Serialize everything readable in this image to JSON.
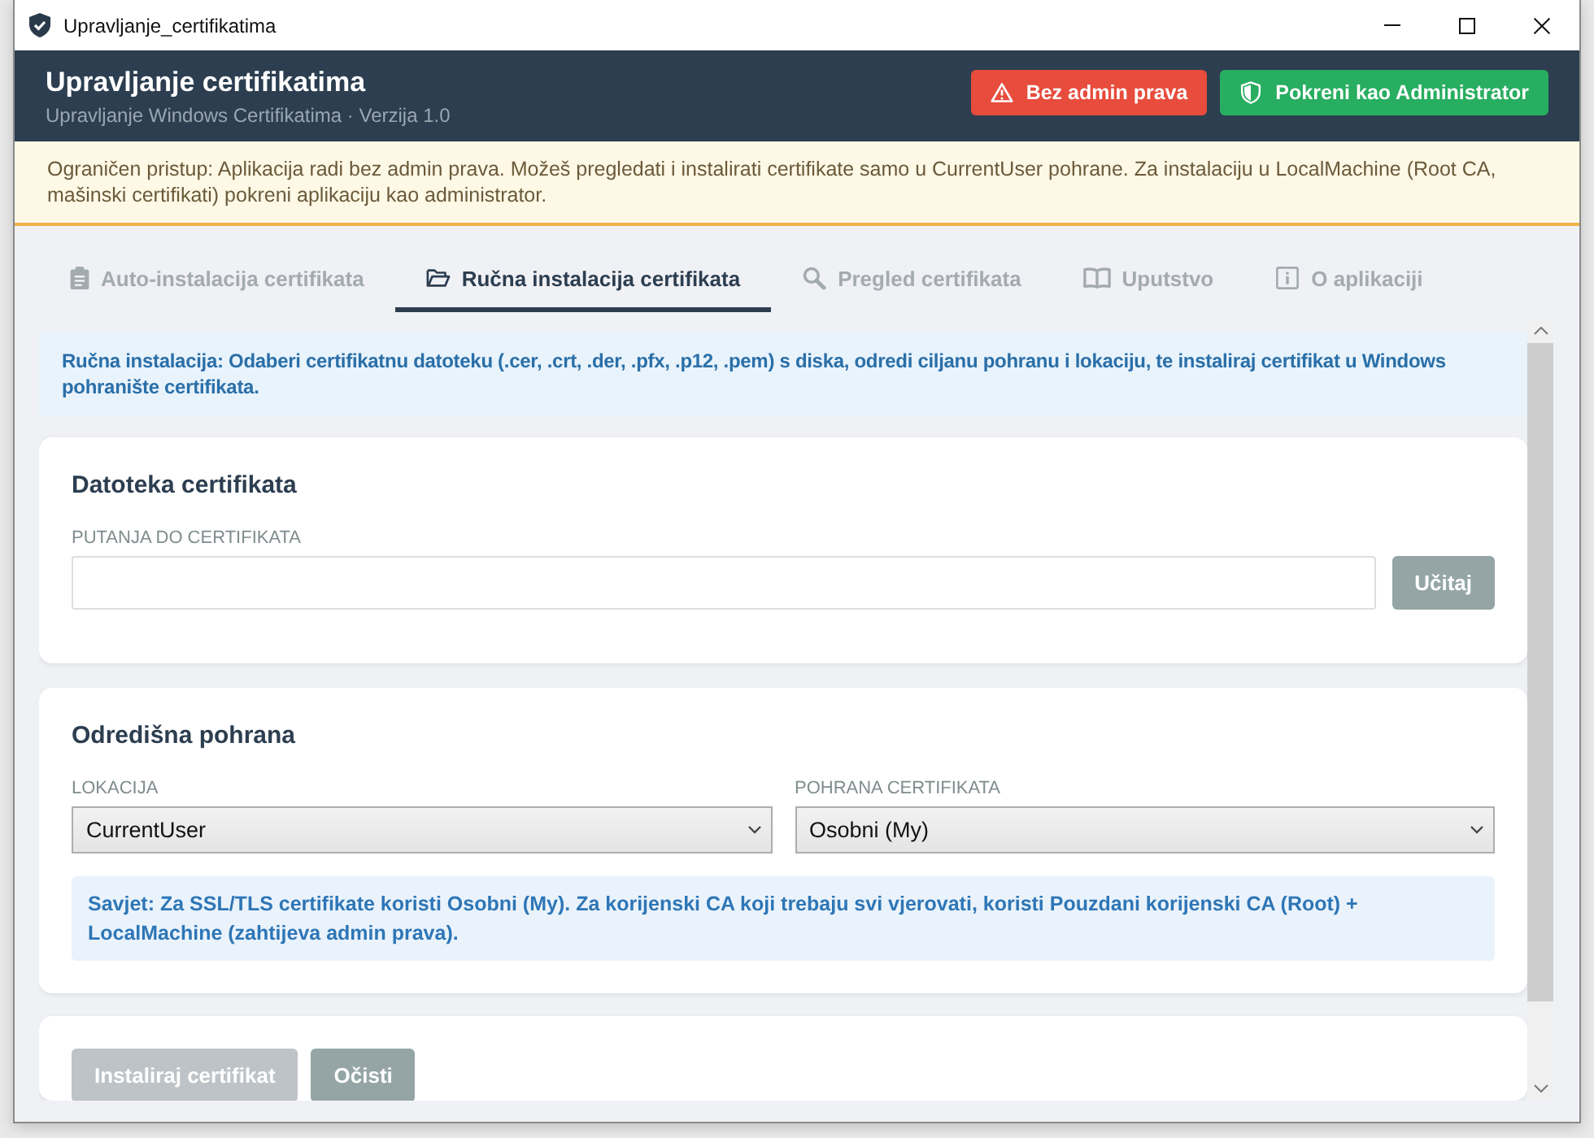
{
  "window": {
    "title": "Upravljanje_certifikatima"
  },
  "header": {
    "title": "Upravljanje certifikatima",
    "subtitle": "Upravljanje Windows Certifikatima · Verzija 1.0",
    "buttons": [
      {
        "kind": "warning",
        "label": "Bez admin prava"
      },
      {
        "kind": "elevate",
        "label": "Pokreni kao Administrator"
      }
    ]
  },
  "access_banner": {
    "text": "Ograničen pristup: Aplikacija radi bez admin prava. Možeš pregledati i instalirati certifikate samo u CurrentUser pohrane. Za instalaciju u LocalMachine (Root CA, mašinski certifikati) pokreni aplikaciju kao administrator."
  },
  "tabs": [
    {
      "label": "Auto-instalacija certifikata",
      "selected": false
    },
    {
      "label": "Ručna instalacija certifikata",
      "selected": true
    },
    {
      "label": "Pregled certifikata",
      "selected": false
    },
    {
      "label": "Uputstvo",
      "selected": false
    },
    {
      "label": "O aplikaciji",
      "selected": false
    }
  ],
  "info_box": {
    "text": "Ručna instalacija: Odaberi certifikatnu datoteku (.cer, .crt, .der, .pfx, .p12, .pem) s diska, odredi ciljanu pohranu i lokaciju, te instaliraj certifikat u Windows pohranište certifikata."
  },
  "file_card": {
    "title": "Datoteka certifikata",
    "path_field": {
      "label": "PUTANJA DO CERTIFIKATA"
    },
    "load_button": {
      "label": "Učitaj"
    }
  },
  "store_card": {
    "title": "Odredišna pohrana",
    "location": {
      "label": "LOKACIJA",
      "value": "CurrentUser"
    },
    "store": {
      "label": "POHRANA CERTIFIKATA",
      "value": "Osobni (My)"
    },
    "tip": "Savjet: Za SSL/TLS certifikate koristi Osobni (My). Za korijenski CA koji trebaju svi vjerovati, koristi Pouzdani korijenski CA (Root) + LocalMachine (zahtijeva admin prava)."
  },
  "actions": [
    {
      "label": "Instaliraj certifikat",
      "disabled": true
    },
    {
      "label": "Očisti",
      "disabled": false
    }
  ]
}
